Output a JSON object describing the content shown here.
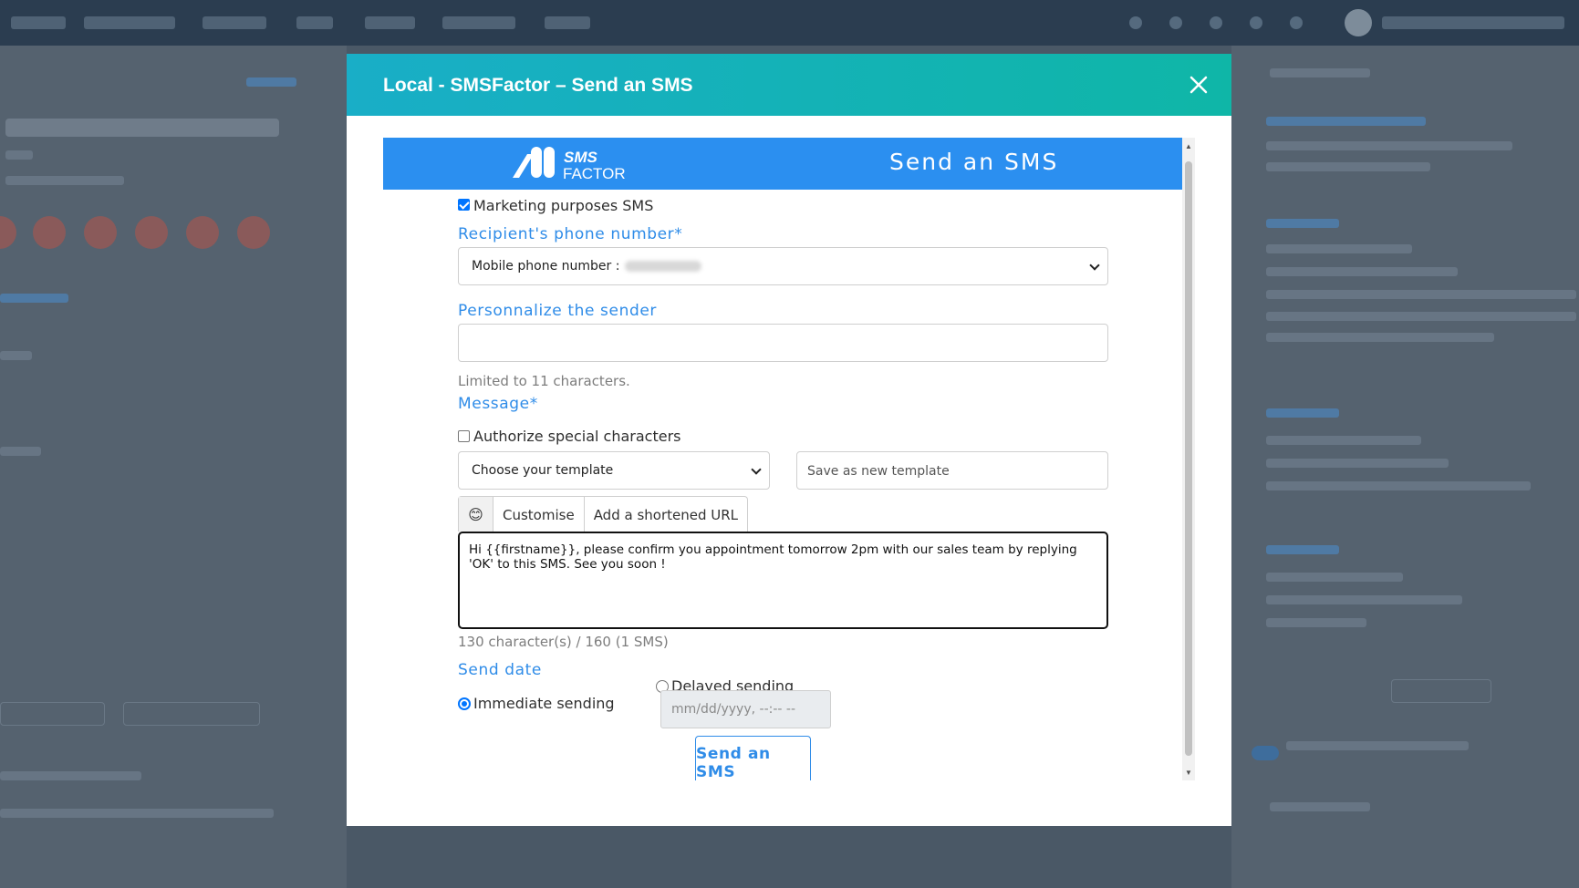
{
  "modal": {
    "title": "Local - SMSFactor – Send an SMS",
    "close_icon": "close-icon"
  },
  "banner": {
    "logo_line1": "SMS",
    "logo_line2": "FACTOR",
    "title": "Send an SMS",
    "background": "#2b8ff0"
  },
  "form": {
    "marketing_checkbox": {
      "label": "Marketing purposes SMS",
      "checked": true
    },
    "recipient": {
      "label": "Recipient's phone number*",
      "selected": "Mobile phone number :"
    },
    "sender": {
      "label": "Personnalize the sender",
      "value": "",
      "hint": "Limited to 11 characters."
    },
    "message": {
      "label": "Message*",
      "special_chars_checkbox": {
        "label": "Authorize special characters",
        "checked": false
      },
      "template_select": "Choose your template",
      "save_template_placeholder": "Save as new template",
      "tabs": {
        "emoji": "😊",
        "customise": "Customise",
        "shortened_url": "Add a shortened URL"
      },
      "text": "Hi {{firstname}}, please confirm you appointment tomorrow 2pm with our sales team by replying 'OK' to this SMS. See you soon !",
      "counter": "130 character(s) / 160 (1 SMS)"
    },
    "send_date": {
      "label": "Send date",
      "immediate": {
        "label": "Immediate sending",
        "checked": true
      },
      "delayed": {
        "label": "Delayed sending",
        "checked": false
      },
      "datetime_placeholder": "mm/dd/yyyy, --:-- --"
    },
    "submit_label": "Send an SMS"
  },
  "colors": {
    "header_gradient_start": "#19aec7",
    "header_gradient_end": "#0fb6a7",
    "accent": "#2f8ce8"
  }
}
